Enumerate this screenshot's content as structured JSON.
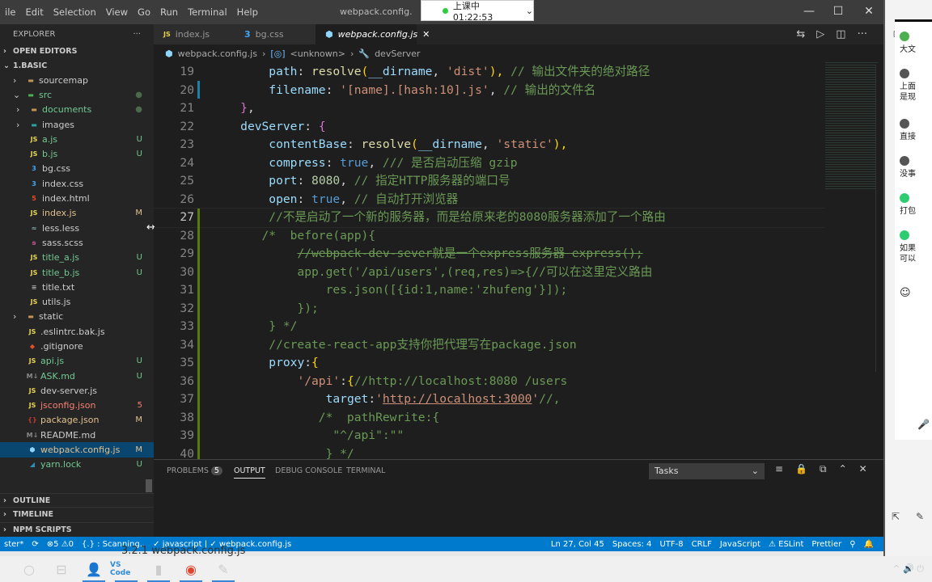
{
  "titlebar": {
    "menu": [
      "ile",
      "Edit",
      "Selection",
      "View",
      "Go",
      "Run",
      "Terminal",
      "Help"
    ],
    "title": "webpack.config.",
    "controls": [
      "—",
      "☐",
      "✕"
    ]
  },
  "timer": {
    "label": "上课中 01:22:53",
    "chevron": "⌄"
  },
  "sidebar": {
    "title": "EXPLORER",
    "more": "···",
    "open_editors": "OPEN EDITORS",
    "root": "1.BASIC",
    "files": [
      {
        "name": "sourcemap",
        "icon": "folder",
        "kind": "folder",
        "level": 1,
        "color": "#cccccc",
        "badge": ""
      },
      {
        "name": "src",
        "icon": "folder-open",
        "kind": "folder-open",
        "level": 1,
        "color": "#73c991",
        "badge": "●"
      },
      {
        "name": "documents",
        "icon": "folder",
        "kind": "folder",
        "level": 2,
        "color": "#73c991",
        "badge": "●"
      },
      {
        "name": "images",
        "icon": "folder-images",
        "kind": "folder",
        "level": 2,
        "color": "#cccccc",
        "badge": ""
      },
      {
        "name": "a.js",
        "icon": "JS",
        "kind": "file",
        "level": 2,
        "color": "#73c991",
        "badge": "U"
      },
      {
        "name": "b.js",
        "icon": "JS",
        "kind": "file",
        "level": 2,
        "color": "#73c991",
        "badge": "U"
      },
      {
        "name": "bg.css",
        "icon": "css",
        "kind": "file",
        "level": 2,
        "color": "#cccccc",
        "badge": ""
      },
      {
        "name": "index.css",
        "icon": "css",
        "kind": "file",
        "level": 2,
        "color": "#cccccc",
        "badge": ""
      },
      {
        "name": "index.html",
        "icon": "html",
        "kind": "file",
        "level": 2,
        "color": "#cccccc",
        "badge": ""
      },
      {
        "name": "index.js",
        "icon": "JS",
        "kind": "file",
        "level": 2,
        "color": "#e2c08d",
        "badge": "M"
      },
      {
        "name": "less.less",
        "icon": "less",
        "kind": "file",
        "level": 2,
        "color": "#cccccc",
        "badge": ""
      },
      {
        "name": "sass.scss",
        "icon": "sass",
        "kind": "file",
        "level": 2,
        "color": "#cccccc",
        "badge": ""
      },
      {
        "name": "title_a.js",
        "icon": "JS",
        "kind": "file",
        "level": 2,
        "color": "#73c991",
        "badge": "U"
      },
      {
        "name": "title_b.js",
        "icon": "JS",
        "kind": "file",
        "level": 2,
        "color": "#73c991",
        "badge": "U"
      },
      {
        "name": "title.txt",
        "icon": "txt",
        "kind": "file",
        "level": 2,
        "color": "#cccccc",
        "badge": ""
      },
      {
        "name": "utils.js",
        "icon": "JS",
        "kind": "file",
        "level": 2,
        "color": "#cccccc",
        "badge": ""
      },
      {
        "name": "static",
        "icon": "folder",
        "kind": "folder",
        "level": 1,
        "color": "#cccccc",
        "badge": ""
      },
      {
        "name": ".eslintrc.bak.js",
        "icon": "JS",
        "kind": "file",
        "level": 1,
        "color": "#cccccc",
        "badge": ""
      },
      {
        "name": ".gitignore",
        "icon": "git",
        "kind": "file",
        "level": 1,
        "color": "#cccccc",
        "badge": ""
      },
      {
        "name": "api.js",
        "icon": "JS",
        "kind": "file",
        "level": 1,
        "color": "#73c991",
        "badge": "U"
      },
      {
        "name": "ASK.md",
        "icon": "md",
        "kind": "file",
        "level": 1,
        "color": "#73c991",
        "badge": "U"
      },
      {
        "name": "dev-server.js",
        "icon": "JS",
        "kind": "file",
        "level": 1,
        "color": "#cccccc",
        "badge": ""
      },
      {
        "name": "jsconfig.json",
        "icon": "JS",
        "kind": "file",
        "level": 1,
        "color": "#f88070",
        "badge": "5"
      },
      {
        "name": "package.json",
        "icon": "json",
        "kind": "file",
        "level": 1,
        "color": "#e2c08d",
        "badge": "M"
      },
      {
        "name": "README.md",
        "icon": "md",
        "kind": "file",
        "level": 1,
        "color": "#cccccc",
        "badge": ""
      },
      {
        "name": "webpack.config.js",
        "icon": "webpack",
        "kind": "file",
        "level": 1,
        "color": "#e2c08d",
        "badge": "M",
        "selected": true
      },
      {
        "name": "yarn.lock",
        "icon": "yarn",
        "kind": "file",
        "level": 1,
        "color": "#73c991",
        "badge": "U"
      }
    ],
    "outline": "OUTLINE",
    "timeline": "TIMELINE",
    "npm": "NPM SCRIPTS"
  },
  "tabs": [
    {
      "label": "index.js",
      "icon": "JS"
    },
    {
      "label": "bg.css",
      "icon": "css"
    },
    {
      "label": "webpack.config.js",
      "icon": "webpack",
      "active": true,
      "close": "✕"
    }
  ],
  "editor_actions": [
    "⇆",
    "▷",
    "◫",
    "···"
  ],
  "breadcrumb": [
    "webpack.config.js",
    "<unknown>",
    "devServer"
  ],
  "code": [
    {
      "n": "19",
      "t": [
        [
          "        ",
          "tx"
        ],
        [
          "path",
          "prop"
        ],
        [
          ": ",
          "tx"
        ],
        [
          "resolve",
          "fn"
        ],
        [
          "(",
          "br"
        ],
        [
          "__dirname",
          "prop"
        ],
        [
          ", ",
          "tx"
        ],
        [
          "'dist'",
          "str"
        ],
        [
          "), ",
          "br"
        ],
        [
          "// 输出文件夹的绝对路径",
          "cm"
        ]
      ]
    },
    {
      "n": "20",
      "t": [
        [
          "        ",
          "tx"
        ],
        [
          "filename",
          "prop"
        ],
        [
          ": ",
          "tx"
        ],
        [
          "'[name].[hash:10].js'",
          "str"
        ],
        [
          ", ",
          "tx"
        ],
        [
          "// 输出的文件名",
          "cm"
        ]
      ]
    },
    {
      "n": "21",
      "t": [
        [
          "    ",
          "tx"
        ],
        [
          "}",
          "pu"
        ],
        [
          ",",
          "tx"
        ]
      ]
    },
    {
      "n": "22",
      "t": [
        [
          "    ",
          "tx"
        ],
        [
          "devServer",
          "prop"
        ],
        [
          ": ",
          "tx"
        ],
        [
          "{",
          "pu"
        ]
      ]
    },
    {
      "n": "23",
      "t": [
        [
          "        ",
          "tx"
        ],
        [
          "contentBase",
          "prop"
        ],
        [
          ": ",
          "tx"
        ],
        [
          "resolve",
          "fn"
        ],
        [
          "(",
          "br"
        ],
        [
          "__dirname",
          "prop"
        ],
        [
          ", ",
          "tx"
        ],
        [
          "'static'",
          "str"
        ],
        [
          "),",
          "br"
        ]
      ]
    },
    {
      "n": "24",
      "t": [
        [
          "        ",
          "tx"
        ],
        [
          "compress",
          "prop"
        ],
        [
          ": ",
          "tx"
        ],
        [
          "true",
          "kw"
        ],
        [
          ", ",
          "tx"
        ],
        [
          "/// 是否启动压缩 gzip",
          "cm"
        ]
      ]
    },
    {
      "n": "25",
      "t": [
        [
          "        ",
          "tx"
        ],
        [
          "port",
          "prop"
        ],
        [
          ": ",
          "tx"
        ],
        [
          "8080",
          "num"
        ],
        [
          ", ",
          "tx"
        ],
        [
          "// 指定HTTP服务器的端口号",
          "cm"
        ]
      ]
    },
    {
      "n": "26",
      "t": [
        [
          "        ",
          "tx"
        ],
        [
          "open",
          "prop"
        ],
        [
          ": ",
          "tx"
        ],
        [
          "true",
          "kw"
        ],
        [
          ", ",
          "tx"
        ],
        [
          "// 自动打开浏览器",
          "cm"
        ]
      ]
    },
    {
      "n": "27",
      "t": [
        [
          "        ",
          "tx"
        ],
        [
          "//不是启动了一个新的服务器，而是给原来老的8080服务器添加了一个路由",
          "cm"
        ]
      ],
      "cur": true
    },
    {
      "n": "28",
      "t": [
        [
          "       /*  before(app){",
          "cm"
        ]
      ]
    },
    {
      "n": "29",
      "t": [
        [
          "            ",
          "tx"
        ],
        [
          "//webpack-dev-sever就是一个express服务器 express();",
          "strike"
        ]
      ]
    },
    {
      "n": "30",
      "t": [
        [
          "            app.get('/api/users',(req,res)=>{//可以在这里定义路由",
          "cm"
        ]
      ]
    },
    {
      "n": "31",
      "t": [
        [
          "                res.json([{id:1,name:'zhufeng'}]);",
          "cm"
        ]
      ]
    },
    {
      "n": "32",
      "t": [
        [
          "            });",
          "cm"
        ]
      ]
    },
    {
      "n": "33",
      "t": [
        [
          "        } */",
          "cm"
        ]
      ]
    },
    {
      "n": "34",
      "t": [
        [
          "        //create-react-app支持你把代理写在package.json",
          "cm"
        ]
      ]
    },
    {
      "n": "35",
      "t": [
        [
          "        ",
          "tx"
        ],
        [
          "proxy",
          "prop"
        ],
        [
          ":",
          "tx"
        ],
        [
          "{",
          "br"
        ]
      ]
    },
    {
      "n": "36",
      "t": [
        [
          "            ",
          "tx"
        ],
        [
          "'/api'",
          "str"
        ],
        [
          ":",
          "tx"
        ],
        [
          "{",
          "br"
        ],
        [
          "//",
          "cm"
        ],
        [
          "http://localhost:8080",
          "cm"
        ],
        [
          " /users",
          "cm"
        ]
      ]
    },
    {
      "n": "37",
      "t": [
        [
          "                ",
          "tx"
        ],
        [
          "target",
          "prop"
        ],
        [
          ":",
          "tx"
        ],
        [
          "'",
          "str"
        ],
        [
          "http://localhost:3000",
          "url"
        ],
        [
          "'",
          "str"
        ],
        [
          "//,",
          "cm"
        ]
      ]
    },
    {
      "n": "38",
      "t": [
        [
          "               /*  pathRewrite:{",
          "cm"
        ]
      ]
    },
    {
      "n": "39",
      "t": [
        [
          "                 \"^/api\":\"\"",
          "cm"
        ]
      ]
    },
    {
      "n": "40",
      "t": [
        [
          "                } */",
          "cm"
        ]
      ]
    }
  ],
  "panel": {
    "tabs": [
      "PROBLEMS",
      "OUTPUT",
      "DEBUG CONSOLE",
      "TERMINAL"
    ],
    "problems_count": "5",
    "active": "OUTPUT",
    "task_select": "Tasks",
    "actions": [
      "≡",
      "🔒",
      "⧉",
      "⌃",
      "✕"
    ]
  },
  "status": {
    "left": [
      "ster*",
      "⟳",
      "⊗5 ⚠0",
      "{.} : Scanning..",
      "✓ javascript | ✓ webpack.config.js"
    ],
    "right": [
      "Ln 27, Col 45",
      "Spaces: 4",
      "UTF-8",
      "CRLF",
      "JavaScript",
      "⚠ ESLint",
      "Prettier",
      "⚲",
      "🔔"
    ]
  },
  "overlay_text": "3.2.1 webpack.config.js",
  "taskbar": {
    "items": [
      "○",
      "⊟",
      "👤",
      "VS Code",
      "▮",
      "◉",
      "✎"
    ],
    "tray": "^ 🔊 ⏻"
  },
  "chat": {
    "messages": [
      "大文",
      "上面\n是现",
      "直接",
      "没事",
      "打包",
      "如果\n可以"
    ]
  }
}
